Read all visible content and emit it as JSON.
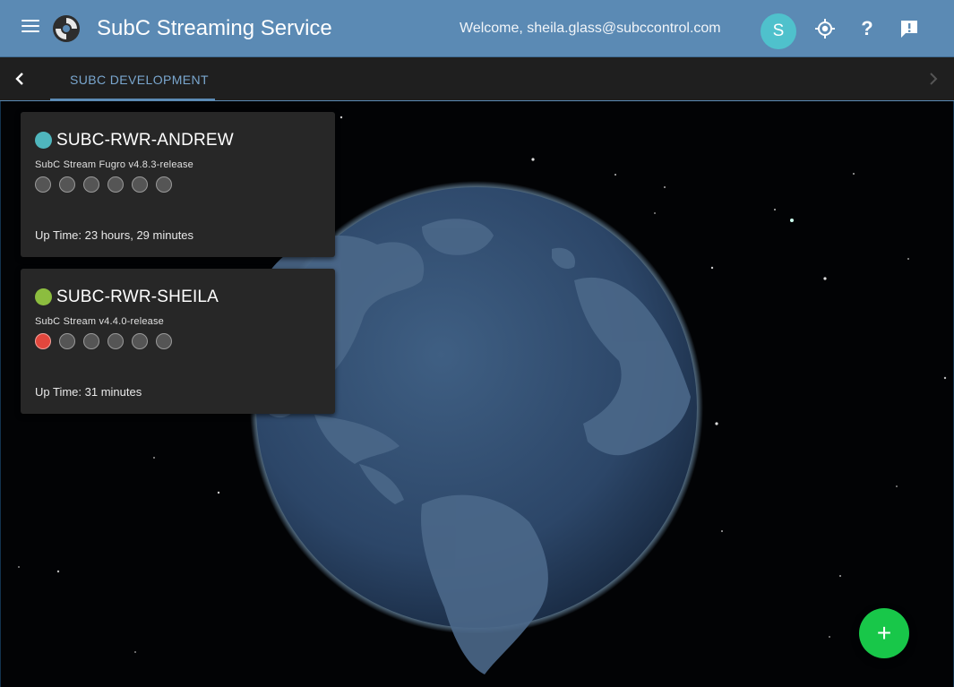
{
  "header": {
    "app_title": "SubC Streaming Service",
    "welcome_text": "Welcome, sheila.glass@subccontrol.com",
    "avatar_initial": "S",
    "icons": {
      "menu": "menu-icon",
      "logo": "subc-logo-icon",
      "locate": "gps-locate-icon",
      "help": "help-icon",
      "feedback": "feedback-icon"
    },
    "help_glyph": "?"
  },
  "tabs": {
    "items": [
      {
        "label": "SUBC DEVELOPMENT"
      }
    ],
    "prev_icon": "chevron-left-icon",
    "next_icon": "chevron-right-icon"
  },
  "devices": [
    {
      "name": "SUBC-RWR-ANDREW",
      "version": "SubC Stream Fugro v4.8.3-release",
      "uptime": "Up Time: 23 hours, 29 minutes",
      "status_color": "#4fb6bd",
      "indicators": [
        "off",
        "off",
        "off",
        "off",
        "off",
        "off"
      ]
    },
    {
      "name": "SUBC-RWR-SHEILA",
      "version": "SubC Stream v4.4.0-release",
      "uptime": "Up Time: 31 minutes",
      "status_color": "#8cbd3f",
      "indicators": [
        "error",
        "off",
        "off",
        "off",
        "off",
        "off"
      ]
    }
  ],
  "fab": {
    "label": "+",
    "icon": "add-icon"
  },
  "colors": {
    "appbar": "#5b8ab4",
    "tab_accent": "#7aa7cf",
    "indicator_off": "#555555",
    "indicator_error": "#e2473d",
    "fab": "#18c749"
  }
}
